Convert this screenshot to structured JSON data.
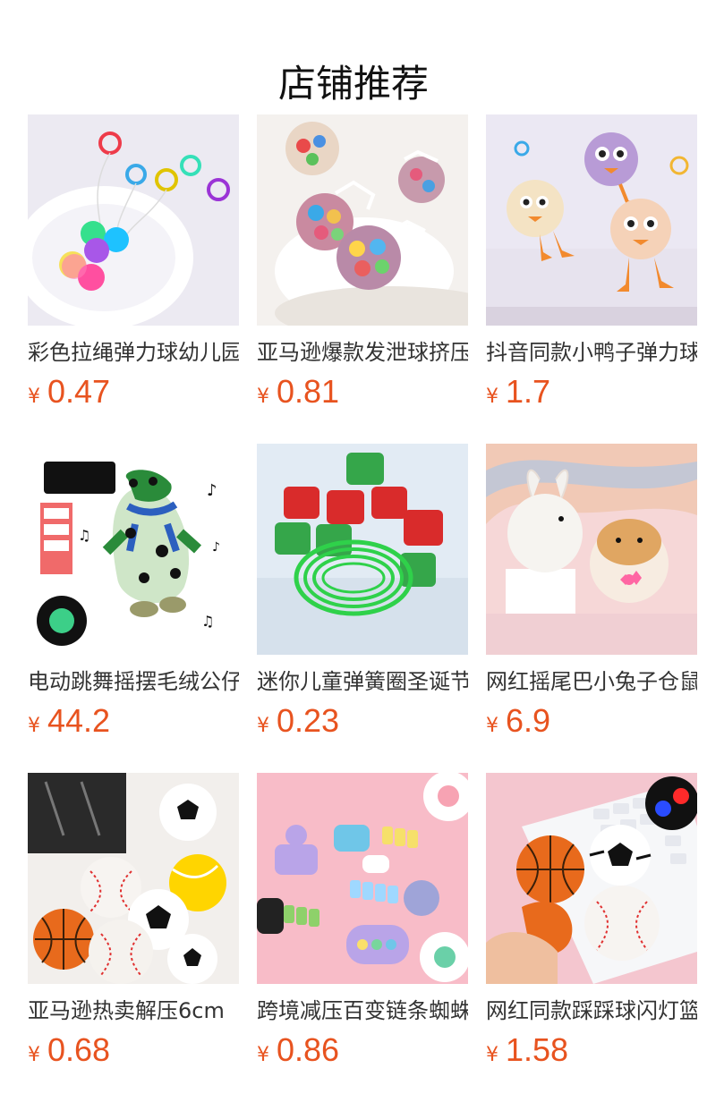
{
  "page": {
    "title": "店铺推荐",
    "currency_symbol": "¥",
    "price_color": "#e8531f"
  },
  "products": [
    {
      "name": "彩色拉绳弹力球幼儿园",
      "price": "0.47",
      "image": "bouncy-balls-with-rings"
    },
    {
      "name": "亚马逊爆款发泄球挤压",
      "price": "0.81",
      "image": "mesh-squeeze-balls"
    },
    {
      "name": "抖音同款小鸭子弹力球",
      "price": "1.7",
      "image": "plush-chick-toys"
    },
    {
      "name": "电动跳舞摇摆毛绒公仔",
      "price": "44.2",
      "image": "dancing-frog-plush"
    },
    {
      "name": "迷你儿童弹簧圈圣诞节",
      "price": "0.23",
      "image": "mini-spring-toys"
    },
    {
      "name": "网红摇尾巴小兔子仓鼠",
      "price": "6.9",
      "image": "plush-bunny-hamster"
    },
    {
      "name": "亚马逊热卖解压6cm",
      "price": "0.68",
      "image": "sports-stress-balls"
    },
    {
      "name": "跨境减压百变链条蜘蛛",
      "price": "0.86",
      "image": "fidget-chain-toys"
    },
    {
      "name": "网红同款踩踩球闪灯篮球",
      "price": "1.58",
      "image": "light-up-sports-balls"
    }
  ]
}
